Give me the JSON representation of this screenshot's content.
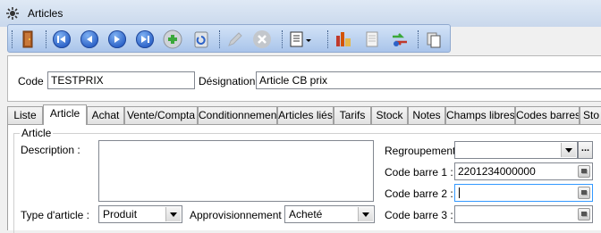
{
  "window": {
    "title": "Articles"
  },
  "toolbar": {
    "buttons": [
      "exit-door-icon",
      "first-record-icon",
      "previous-record-icon",
      "next-record-icon",
      "last-record-icon",
      "add-record-icon",
      "refresh-icon",
      "edit-pencil-icon",
      "delete-icon",
      "report-menu-icon",
      "stock-chart-icon",
      "document-icon",
      "transfer-icon",
      "copy-icon"
    ]
  },
  "header": {
    "code_label": "Code :",
    "code_value": "TESTPRIX",
    "designation_label": "Désignation :",
    "designation_value": "Article CB prix"
  },
  "tabs": [
    {
      "label": "Liste"
    },
    {
      "label": "Article",
      "active": true
    },
    {
      "label": "Achat"
    },
    {
      "label": "Vente/Compta"
    },
    {
      "label": "Conditionnement"
    },
    {
      "label": "Articles liés"
    },
    {
      "label": "Tarifs"
    },
    {
      "label": "Stock"
    },
    {
      "label": "Notes"
    },
    {
      "label": "Champs libres"
    },
    {
      "label": "Codes barres"
    },
    {
      "label": "Sto"
    }
  ],
  "article": {
    "group_title": "Article",
    "description_label": "Description :",
    "description_value": "",
    "type_label": "Type d'article :",
    "type_value": "Produit",
    "appro_label": "Approvisionnement :",
    "appro_value": "Acheté",
    "regroupement_label": "Regroupement :",
    "regroupement_value": "",
    "regroupement_more": "...",
    "barcode1_label": "Code barre 1 :",
    "barcode1_value": "2201234000000",
    "barcode2_label": "Code barre 2 :",
    "barcode2_value": "",
    "barcode3_label": "Code barre 3 :",
    "barcode3_value": ""
  },
  "colors": {
    "toolbar_top": "#d3e3f7",
    "toolbar_bottom": "#a9c4ea",
    "nav_button": "#2d63c8",
    "focus_border": "#3399ff"
  }
}
